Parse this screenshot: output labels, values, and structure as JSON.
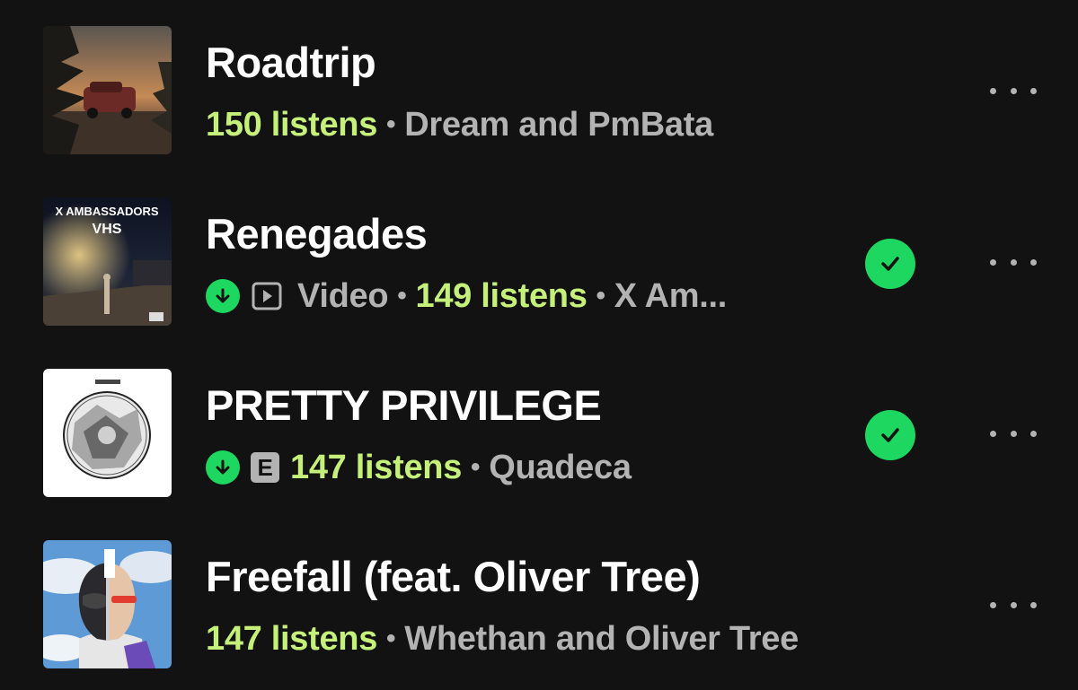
{
  "tracks": [
    {
      "title": "Roadtrip",
      "listens": "150 listens",
      "artist": "Dream and PmBata",
      "downloaded": false,
      "liked": false
    },
    {
      "title": "Renegades",
      "video_label": "Video",
      "listens": "149 listens",
      "artist": "X Am...",
      "cover_text_1": "X AMBASSADORS",
      "cover_text_2": "VHS",
      "downloaded": true,
      "liked": true
    },
    {
      "title": "PRETTY PRIVILEGE",
      "explicit_label": "E",
      "listens": "147 listens",
      "artist": "Quadeca",
      "downloaded": true,
      "liked": true
    },
    {
      "title": "Freefall (feat. Oliver Tree)",
      "listens": "147 listens",
      "artist": "Whethan and Oliver Tree",
      "downloaded": false,
      "liked": false
    }
  ],
  "colors": {
    "background": "#121212",
    "listens": "#c5f07a",
    "accent_green": "#1ed760",
    "secondary_text": "#b3b3b3"
  },
  "icons": [
    "download-icon",
    "video-icon",
    "explicit-icon",
    "check-icon",
    "more-options-icon"
  ]
}
